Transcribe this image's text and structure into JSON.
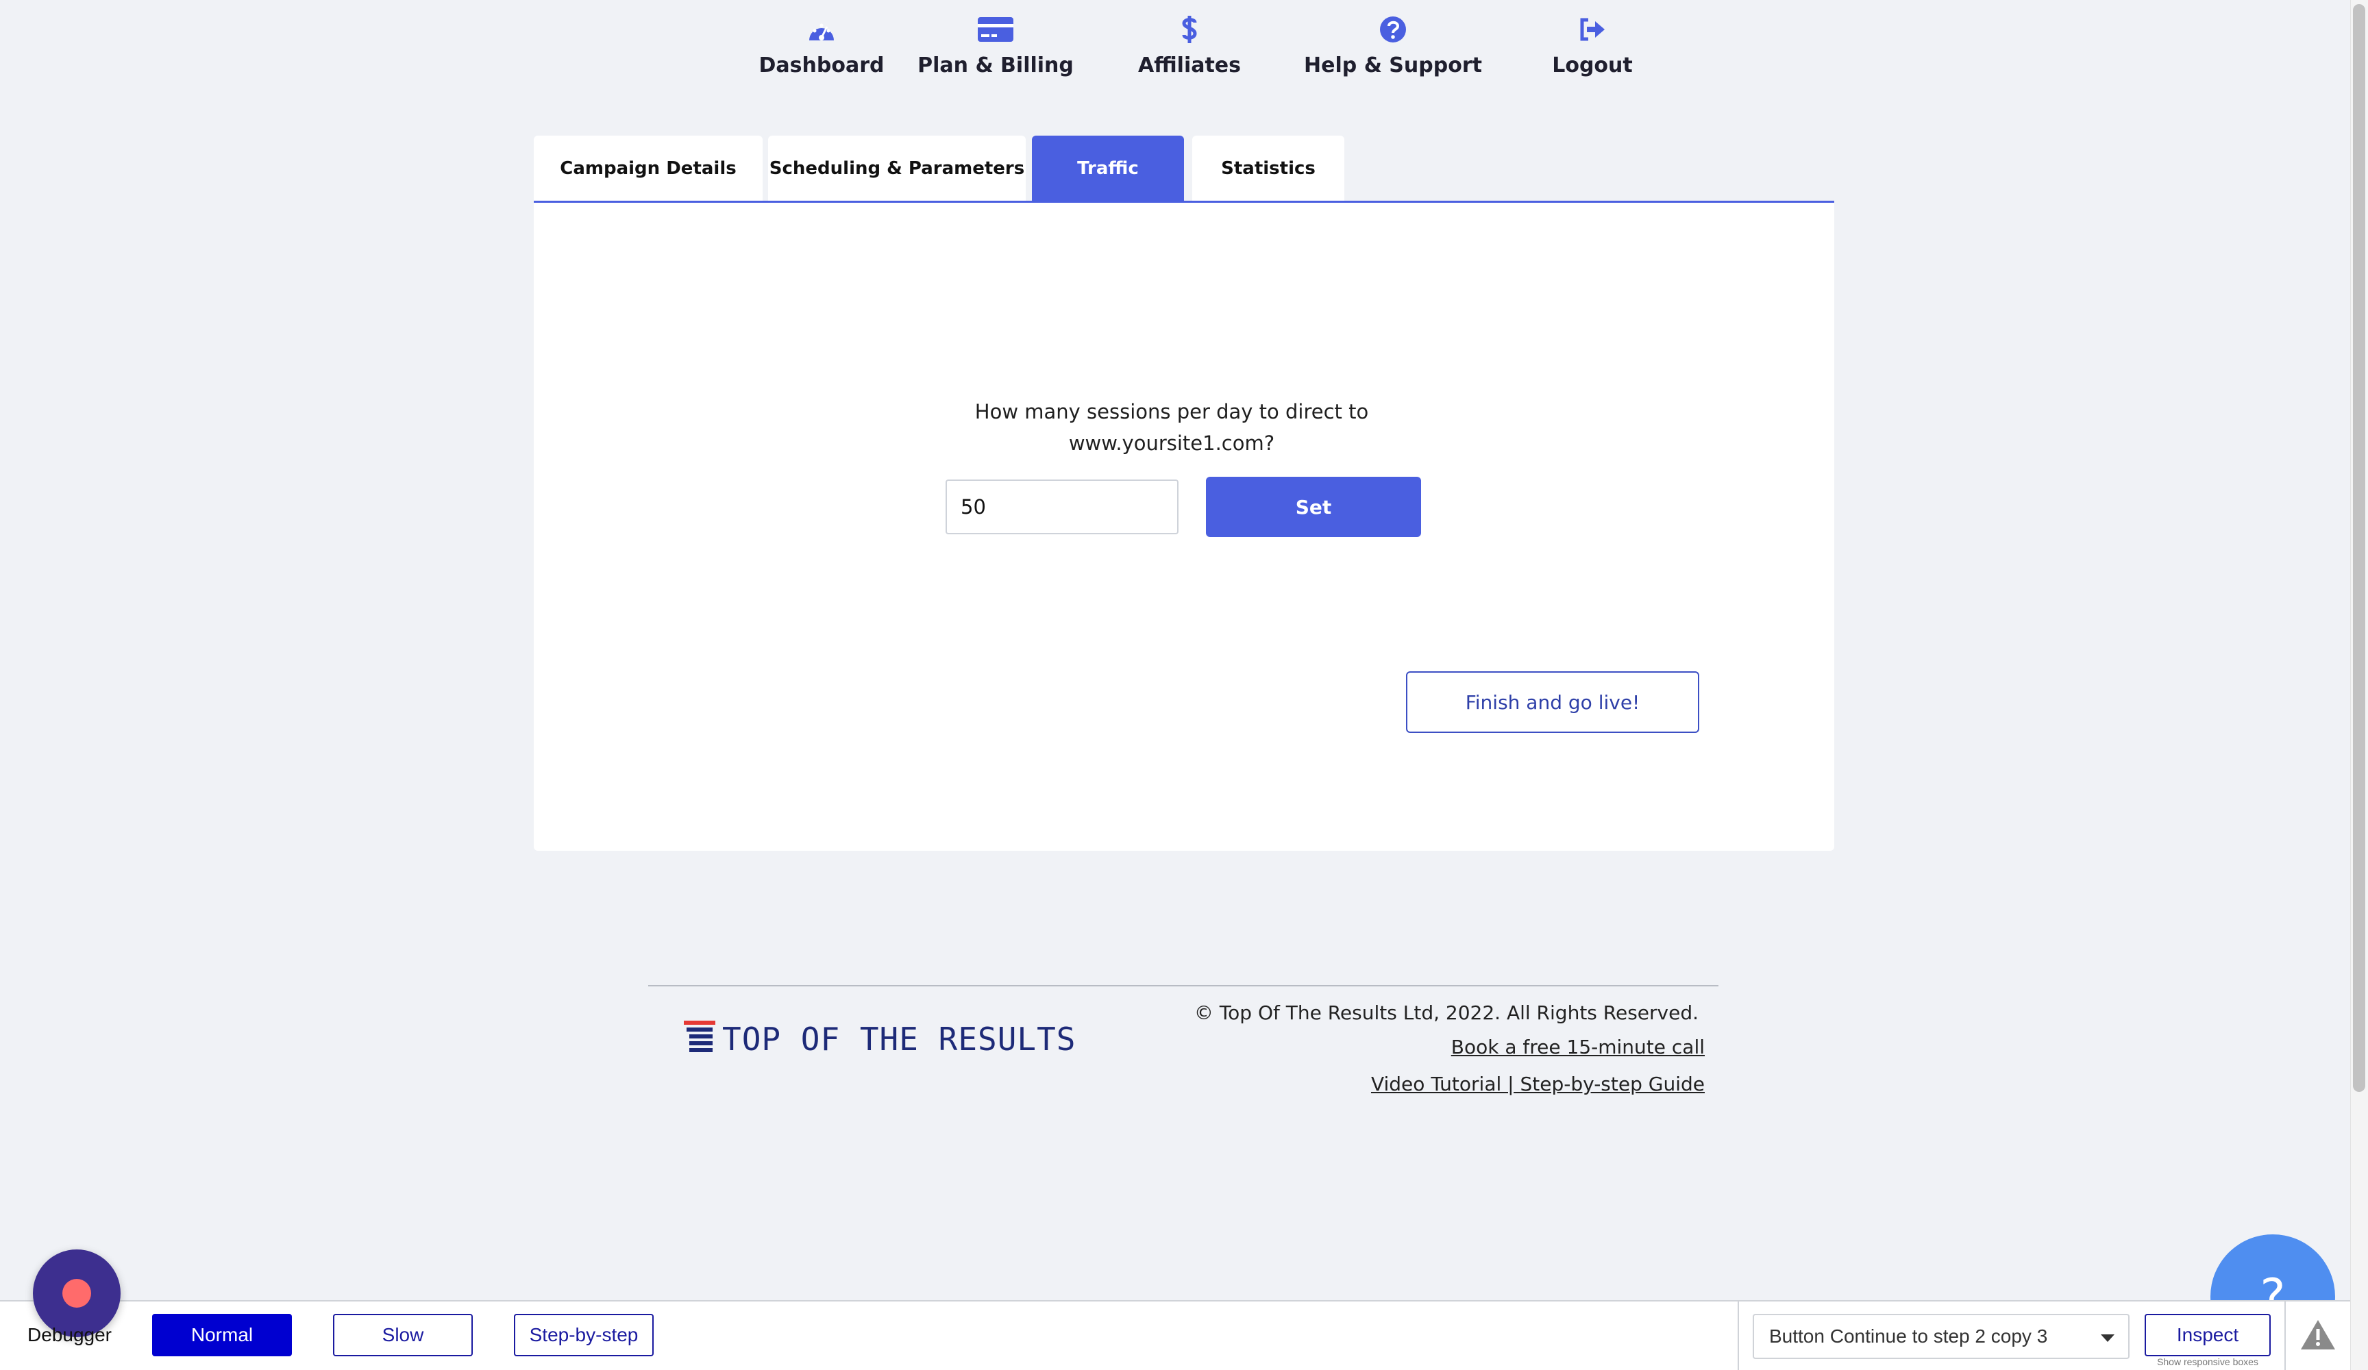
{
  "nav": {
    "items": [
      {
        "label": "Dashboard",
        "icon": "dashboard-gauge-icon"
      },
      {
        "label": "Plan & Billing",
        "icon": "credit-card-icon"
      },
      {
        "label": "Affiliates",
        "icon": "dollar-icon"
      },
      {
        "label": "Help & Support",
        "icon": "question-circle-icon"
      },
      {
        "label": "Logout",
        "icon": "logout-icon"
      }
    ],
    "accent": "#4a5fe0"
  },
  "tabs": [
    {
      "label": "Campaign Details",
      "active": false
    },
    {
      "label": "Scheduling & Parameters",
      "active": false
    },
    {
      "label": "Traffic",
      "active": true
    },
    {
      "label": "Statistics",
      "active": false
    }
  ],
  "traffic": {
    "question_line1": "How many sessions per day to direct to",
    "question_line2": "www.yoursite1.com?",
    "sessions_value": "50",
    "set_label": "Set",
    "finish_label": "Finish and go live!"
  },
  "footer": {
    "logo_text": "TOP OF THE RESULTS",
    "copyright": "© Top Of The Results Ltd, 2022. All Rights Reserved.",
    "link_call": "Book a free 15-minute call",
    "link_guide": "Video Tutorial | Step-by-step Guide"
  },
  "help": {
    "glyph": "?"
  },
  "debugger": {
    "label": "Debugger",
    "modes": [
      {
        "label": "Normal",
        "active": true
      },
      {
        "label": "Slow",
        "active": false
      },
      {
        "label": "Step-by-step",
        "active": false
      }
    ],
    "step_selected": "Button Continue to step 2 copy 3",
    "inspect_label": "Inspect",
    "inspect_sub": "Show responsive boxes"
  }
}
